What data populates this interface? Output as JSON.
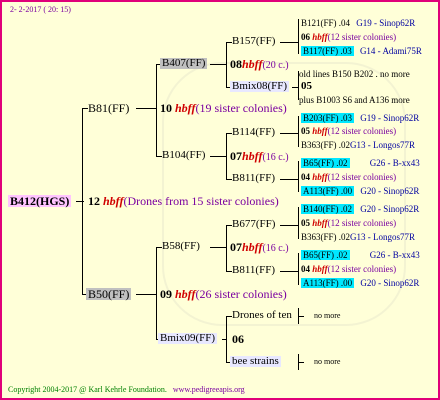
{
  "header": {
    "date_text": "2- 2-2017 ( 20: 15)"
  },
  "footer": {
    "copyright": "Copyright 2004-2017 @ Karl Kehrle Foundation.",
    "site": "www.pedigreeapis.org"
  },
  "root": {
    "name": "B412(HGS)",
    "num": "12",
    "hbff": "hbff",
    "note": "(Drones from 15 sister colonies)"
  },
  "gen1": {
    "top": {
      "name": "B81(FF)",
      "num": "10",
      "hbff": "hbff",
      "note": "(19 sister colonies)"
    },
    "bottom": {
      "name": "B50(FF)",
      "num": "09",
      "hbff": "hbff",
      "note": "(26 sister colonies)"
    }
  },
  "gen2": {
    "b407": {
      "name": "B407(FF)",
      "num": "08",
      "hbff": "hbff",
      "note": "(20 c.)"
    },
    "b104": {
      "name": "B104(FF)",
      "num": "07",
      "hbff": "hbff",
      "note": "(16 c.)"
    },
    "b58": {
      "name": "B58(FF)",
      "num": "07",
      "hbff": "hbff",
      "note": "(16 c.)"
    },
    "bmix09": {
      "name": "Bmix09(FF)",
      "num": "06"
    }
  },
  "gen3": {
    "b157": {
      "name": "B157(FF)"
    },
    "bmix08": {
      "name": "Bmix08(FF)",
      "num": "05"
    },
    "b114": {
      "name": "B114(FF)",
      "num": "05",
      "hbff": "hbff",
      "note": "(12 sister colonies)"
    },
    "b811a": {
      "name": "B811(FF)",
      "num": "04",
      "hbff": "hbff",
      "note": "(12 sister colonies)"
    },
    "b677": {
      "name": "B677(FF)",
      "num": "05",
      "hbff": "hbff",
      "note": "(12 sister colonies)"
    },
    "b811b": {
      "name": "B811(FF)",
      "num": "04",
      "hbff": "hbff",
      "note": "(12 sister colonies)"
    },
    "drones": {
      "name": "Drones of ten",
      "more": "no more"
    },
    "bee": {
      "name": "bee strains",
      "more": "no more"
    }
  },
  "gen4": {
    "r1": {
      "name": "B121(FF)",
      "val": ".04",
      "loc": "G19 - Sinop62R"
    },
    "r2": {
      "num": "06",
      "hbff": "hbff",
      "note": "(12 sister colonies)"
    },
    "r3": {
      "name": "B117(FF)",
      "val": ".03",
      "loc": "G14 - Adami75R"
    },
    "r4": {
      "text": "old lines B150 B202 . no more"
    },
    "r5": {
      "text": "plus B1003 S6 and A136 more"
    },
    "r6": {
      "name": "B203(FF)",
      "val": ".03",
      "loc": "G19 - Sinop62R"
    },
    "r7": {
      "name": "B363(FF)",
      "val": ".02",
      "loc": "G13 - Longos77R"
    },
    "r8": {
      "name": "B65(FF)",
      "val": ".02",
      "loc": "G26 - B-xx43"
    },
    "r9": {
      "name": "A113(FF)",
      "val": ".00",
      "loc": "G20 - Sinop62R"
    },
    "r10": {
      "name": "B140(FF)",
      "val": ".02",
      "loc": "G20 - Sinop62R"
    },
    "r11": {
      "name": "B363(FF)",
      "val": ".02",
      "loc": "G13 - Longos77R"
    },
    "r12": {
      "name": "B65(FF)",
      "val": ".02",
      "loc": "G26 - B-xx43"
    },
    "r13": {
      "name": "A113(FF)",
      "val": ".00",
      "loc": "G20 - Sinop62R"
    }
  }
}
